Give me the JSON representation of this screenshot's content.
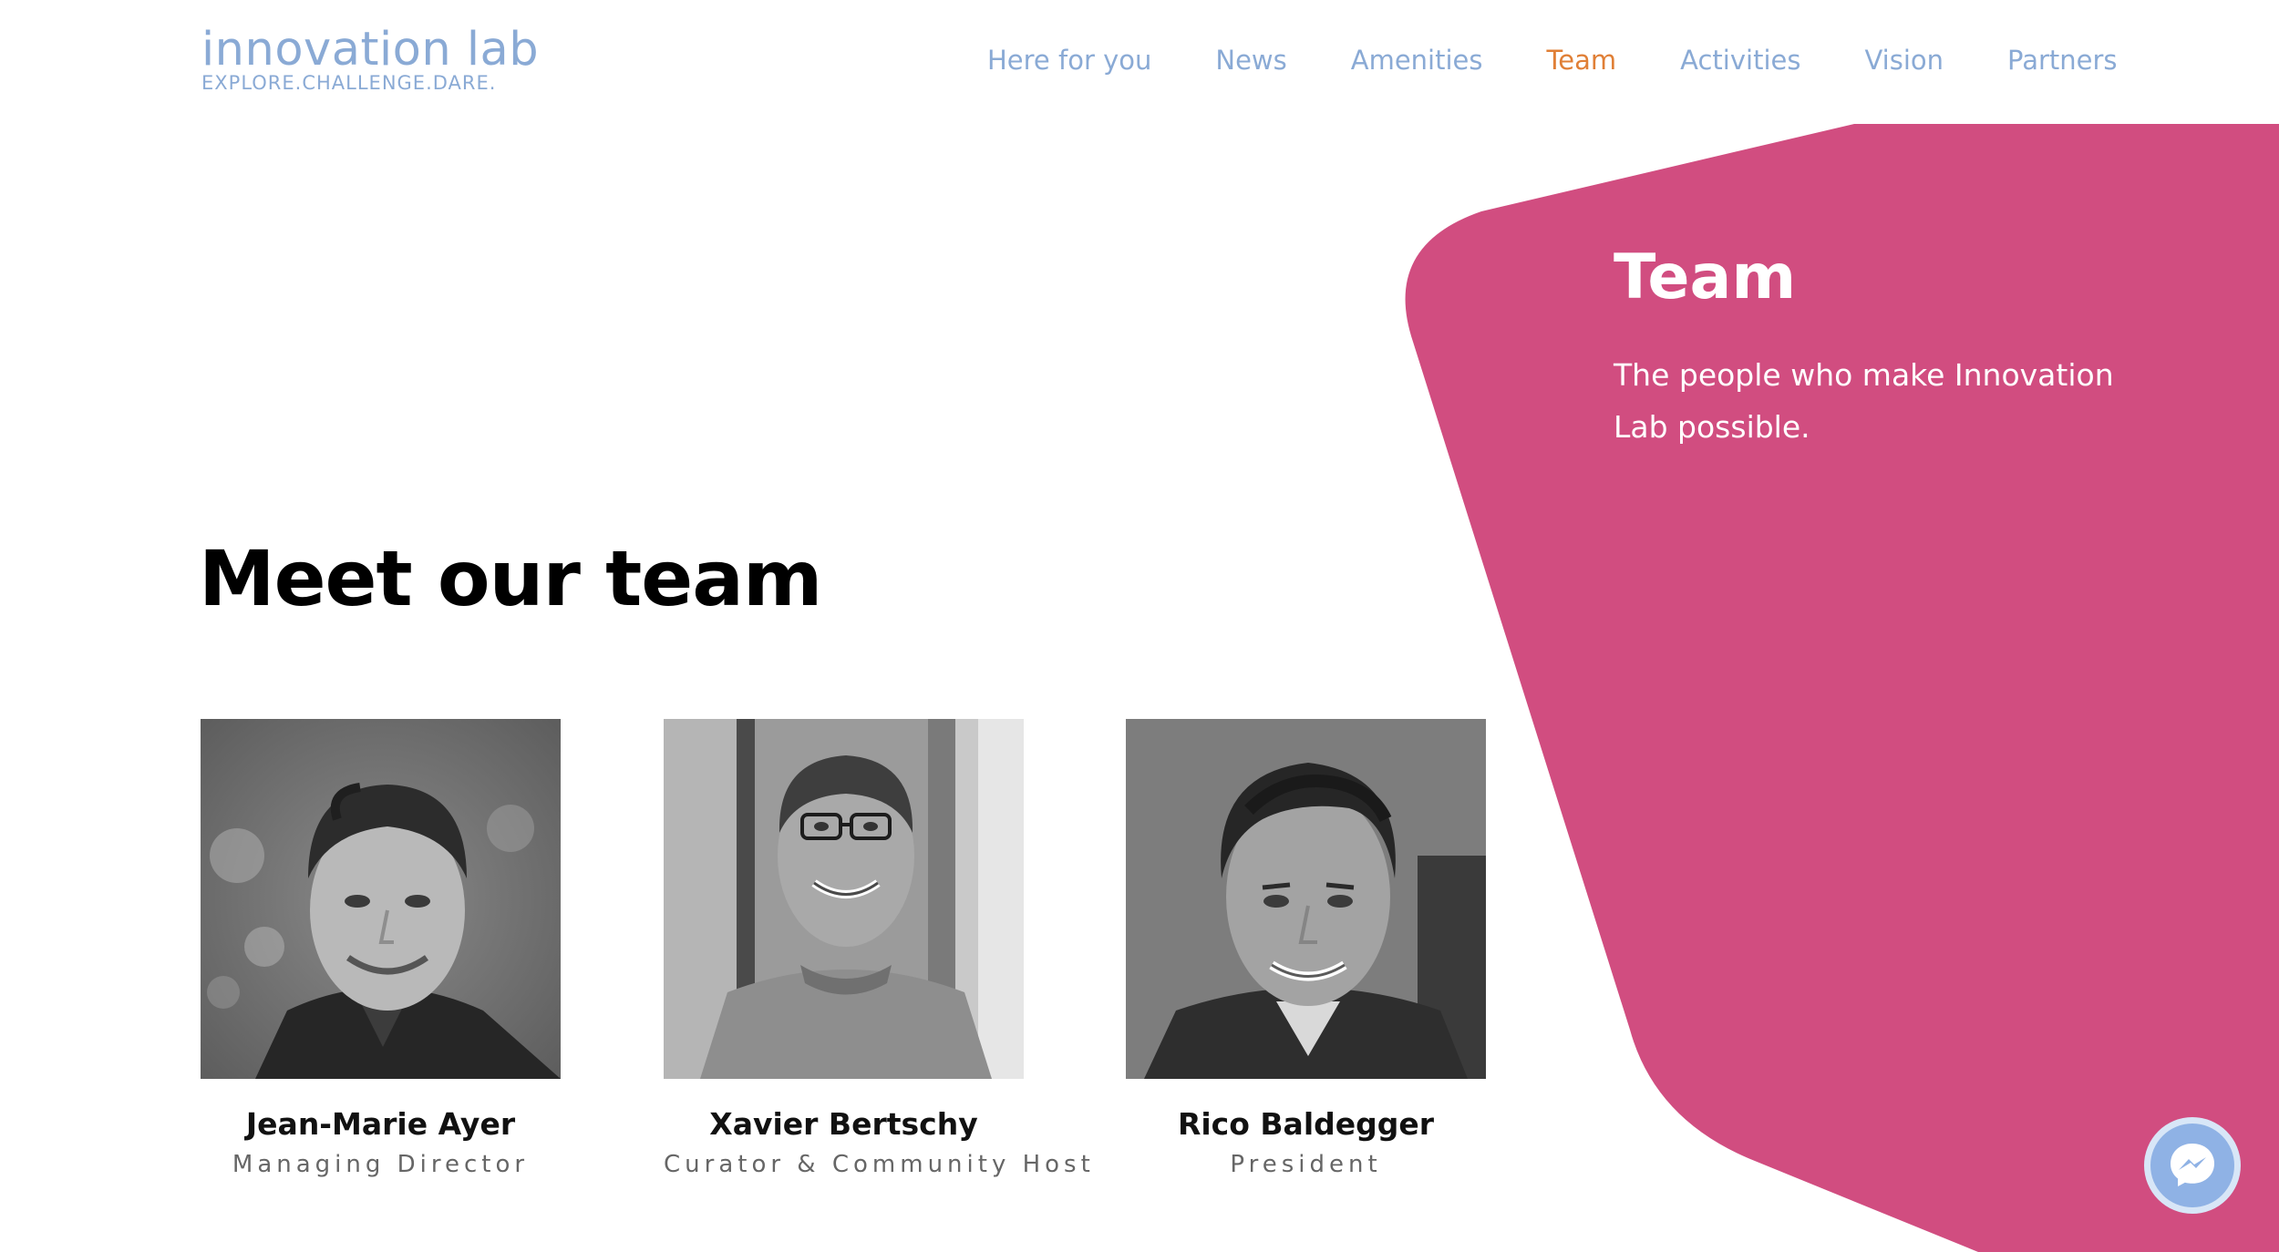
{
  "header": {
    "logo_title": "innovation lab",
    "logo_tagline": "EXPLORE.CHALLENGE.DARE.",
    "nav": [
      {
        "label": "Here for you",
        "active": false
      },
      {
        "label": "News",
        "active": false
      },
      {
        "label": "Amenities",
        "active": false
      },
      {
        "label": "Team",
        "active": true
      },
      {
        "label": "Activities",
        "active": false
      },
      {
        "label": "Vision",
        "active": false
      },
      {
        "label": "Partners",
        "active": false
      }
    ]
  },
  "hero": {
    "title": "Team",
    "subtitle": "The people who make Innovation Lab possible."
  },
  "main": {
    "section_title": "Meet our team",
    "members": [
      {
        "name": "Jean-Marie Ayer",
        "role": "Managing Director"
      },
      {
        "name": "Xavier Bertschy",
        "role": "Curator & Community Host"
      },
      {
        "name": "Rico Baldegger",
        "role": "President"
      }
    ]
  },
  "colors": {
    "accent_pink": "#d14d80",
    "nav_link": "#8aaad5",
    "nav_active": "#e07f36",
    "messenger_blue": "#8fb2e5"
  },
  "icons": {
    "messenger": "messenger-icon"
  }
}
